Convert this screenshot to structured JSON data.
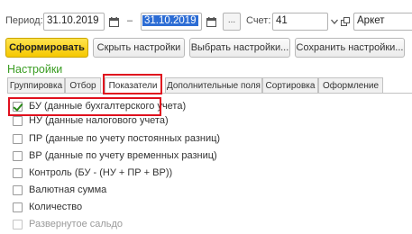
{
  "filters": {
    "period_label": "Период:",
    "date_from": "31.10.2019",
    "dash": "–",
    "date_to": "31.10.2019",
    "ellipsis": "...",
    "account_label": "Счет:",
    "account_value": "41",
    "analytic_value": "Аркет",
    "colors": {
      "selection": "#2d6dd4"
    }
  },
  "toolbar": {
    "generate_label": "Сформировать",
    "hide_settings_label": "Скрыть настройки",
    "choose_settings_label": "Выбрать настройки...",
    "save_settings_label": "Сохранить настройки...",
    "primary_color": "#f5c800"
  },
  "settings": {
    "title": "Настройки",
    "title_color": "#3a9d23",
    "tabs": [
      {
        "label": "Группировка"
      },
      {
        "label": "Отбор"
      },
      {
        "label": "Показатели",
        "active": true
      },
      {
        "label": "Дополнительные поля"
      },
      {
        "label": "Сортировка"
      },
      {
        "label": "Оформление"
      }
    ],
    "items": [
      {
        "label": "БУ (данные бухгалтерского учета)",
        "checked": true
      },
      {
        "label": "НУ (данные налогового учета)",
        "checked": false
      },
      {
        "label": "ПР (данные по учету постоянных разниц)",
        "checked": false
      },
      {
        "label": "ВР (данные по учету временных разниц)",
        "checked": false
      },
      {
        "label": "Контроль (БУ - (НУ + ПР + ВР))",
        "checked": false
      },
      {
        "label": "Валютная сумма",
        "checked": false
      },
      {
        "label": "Количество",
        "checked": false
      },
      {
        "label": "Развернутое сальдо",
        "checked": false,
        "disabled": true
      }
    ],
    "highlight_color": "#e0101e"
  }
}
